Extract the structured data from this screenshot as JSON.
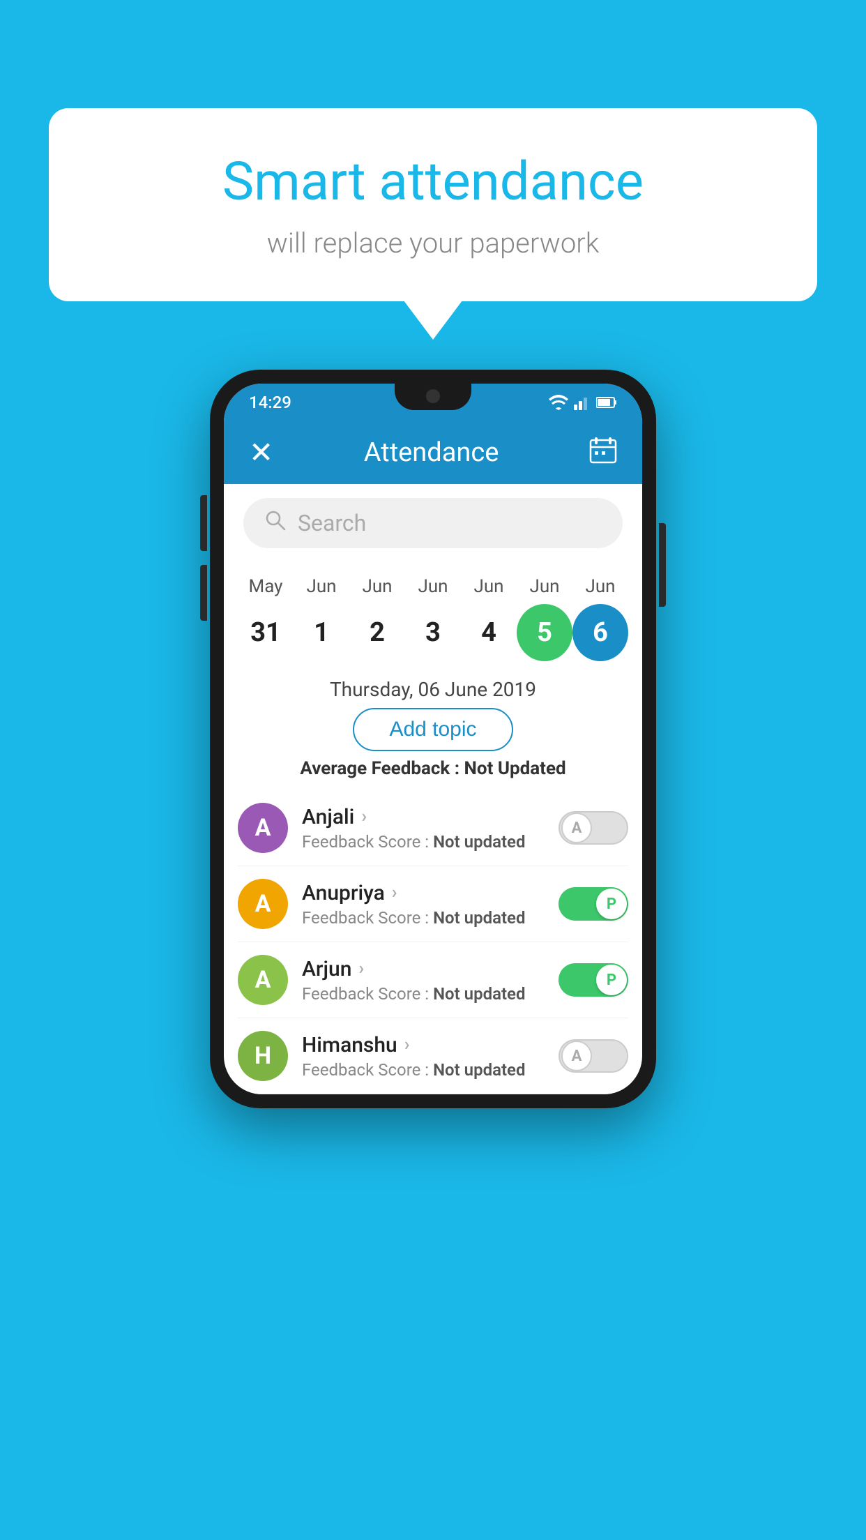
{
  "background_color": "#1ab8e8",
  "speech_bubble": {
    "title": "Smart attendance",
    "subtitle": "will replace your paperwork"
  },
  "status_bar": {
    "time": "14:29"
  },
  "app_header": {
    "title": "Attendance",
    "close_label": "✕",
    "calendar_icon": "📅"
  },
  "search": {
    "placeholder": "Search"
  },
  "calendar": {
    "months": [
      "May",
      "Jun",
      "Jun",
      "Jun",
      "Jun",
      "Jun",
      "Jun"
    ],
    "dates": [
      "31",
      "1",
      "2",
      "3",
      "4",
      "5",
      "6"
    ],
    "styles": [
      "normal",
      "normal",
      "normal",
      "normal",
      "normal",
      "green",
      "blue"
    ]
  },
  "selected_date": "Thursday, 06 June 2019",
  "add_topic_label": "Add topic",
  "avg_feedback": {
    "label": "Average Feedback :",
    "value": "Not Updated"
  },
  "students": [
    {
      "name": "Anjali",
      "initial": "A",
      "avatar_color": "#9b59b6",
      "feedback_label": "Feedback Score :",
      "feedback_value": "Not updated",
      "toggle": "off",
      "toggle_label": "A"
    },
    {
      "name": "Anupriya",
      "initial": "A",
      "avatar_color": "#f0a500",
      "feedback_label": "Feedback Score :",
      "feedback_value": "Not updated",
      "toggle": "on",
      "toggle_label": "P"
    },
    {
      "name": "Arjun",
      "initial": "A",
      "avatar_color": "#8bc34a",
      "feedback_label": "Feedback Score :",
      "feedback_value": "Not updated",
      "toggle": "on",
      "toggle_label": "P"
    },
    {
      "name": "Himanshu",
      "initial": "H",
      "avatar_color": "#7cb342",
      "feedback_label": "Feedback Score :",
      "feedback_value": "Not updated",
      "toggle": "off",
      "toggle_label": "A"
    }
  ]
}
